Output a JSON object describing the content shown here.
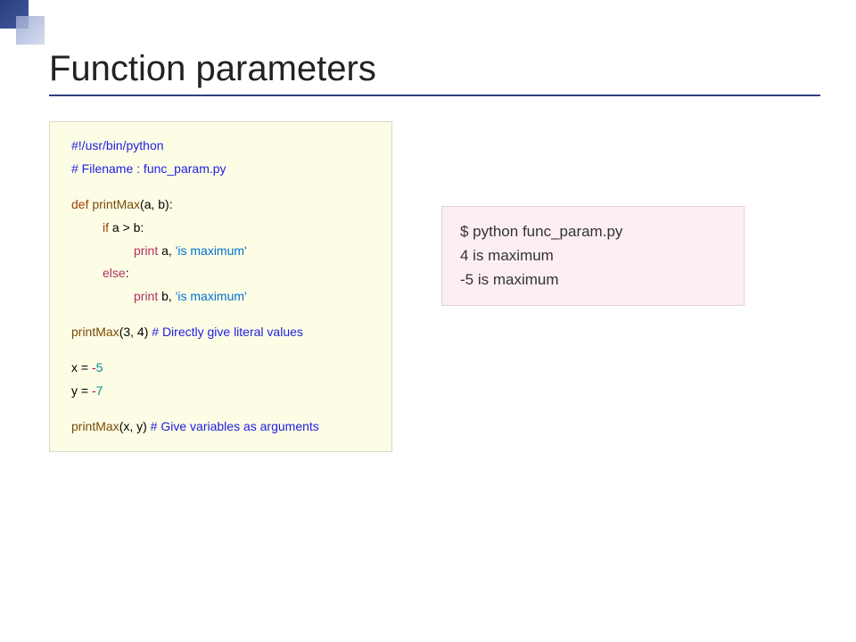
{
  "slide": {
    "title": "Function parameters"
  },
  "code": {
    "l1": "#!/usr/bin/python",
    "l2": "# Filename : func_param.py",
    "def": "def",
    "fn": "printMax",
    "params": "(a, b):",
    "if": "if",
    "cond": "a > b:",
    "print": "print",
    "pa": "a,",
    "pb": "b,",
    "str_max": "'is maximum'",
    "else": "else",
    "colon": ":",
    "call1_args": "(3, 4)",
    "c_call1": " # Directly give literal values",
    "xass": "x = ",
    "yass": "y = ",
    "neg": "-",
    "five": "5",
    "seven": "7",
    "call2_args": "(x, y)",
    "c_call2": " # Give variables as arguments"
  },
  "output": {
    "l1": "$ python func_param.py",
    "l2": "4 is maximum",
    "l3": "-5 is maximum"
  }
}
